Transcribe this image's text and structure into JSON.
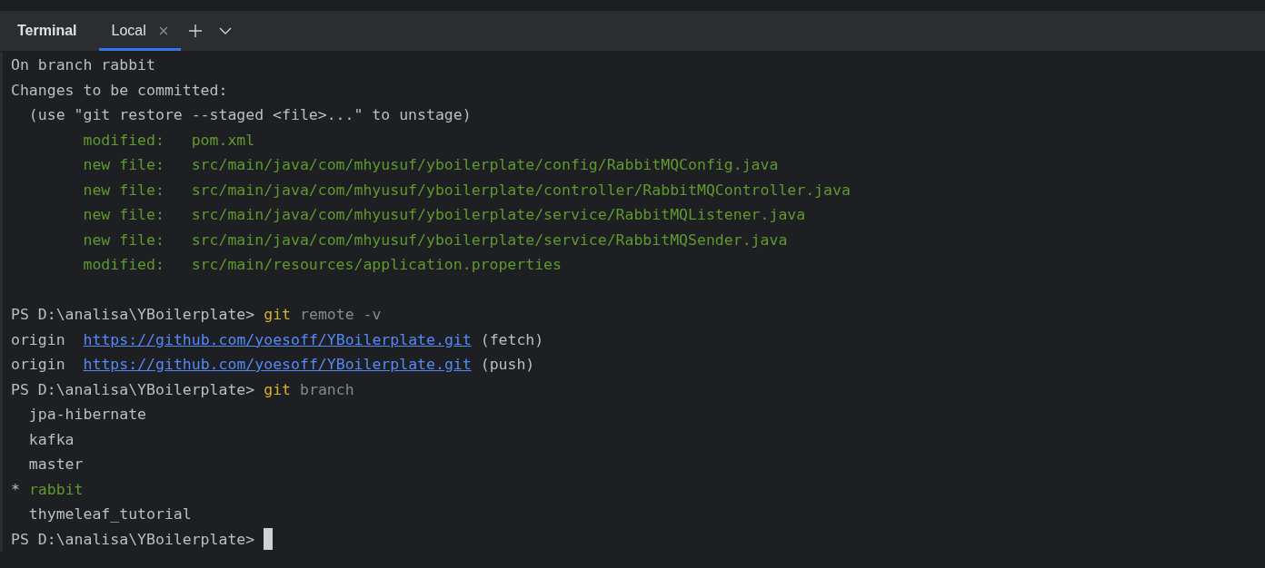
{
  "panel": {
    "title": "Terminal",
    "tabs": [
      {
        "label": "Local",
        "selected": true
      }
    ]
  },
  "lines": [
    {
      "kind": "text",
      "segments": [
        {
          "kind": "plain",
          "text": "On branch rabbit"
        }
      ]
    },
    {
      "kind": "text",
      "segments": [
        {
          "kind": "plain",
          "text": "Changes to be committed:"
        }
      ]
    },
    {
      "kind": "text",
      "segments": [
        {
          "kind": "plain",
          "text": "  (use \"git restore --staged <file>...\" to unstage)"
        }
      ]
    },
    {
      "kind": "text",
      "segments": [
        {
          "kind": "staged",
          "text": "        modified:   pom.xml"
        }
      ]
    },
    {
      "kind": "text",
      "segments": [
        {
          "kind": "staged",
          "text": "        new file:   src/main/java/com/mhyusuf/yboilerplate/config/RabbitMQConfig.java"
        }
      ]
    },
    {
      "kind": "text",
      "segments": [
        {
          "kind": "staged",
          "text": "        new file:   src/main/java/com/mhyusuf/yboilerplate/controller/RabbitMQController.java"
        }
      ]
    },
    {
      "kind": "text",
      "segments": [
        {
          "kind": "staged",
          "text": "        new file:   src/main/java/com/mhyusuf/yboilerplate/service/RabbitMQListener.java"
        }
      ]
    },
    {
      "kind": "text",
      "segments": [
        {
          "kind": "staged",
          "text": "        new file:   src/main/java/com/mhyusuf/yboilerplate/service/RabbitMQSender.java"
        }
      ]
    },
    {
      "kind": "text",
      "segments": [
        {
          "kind": "staged",
          "text": "        modified:   src/main/resources/application.properties"
        }
      ]
    },
    {
      "kind": "blank"
    },
    {
      "kind": "text",
      "segments": [
        {
          "kind": "prompt",
          "text": "PS D:\\analisa\\YBoilerplate>"
        },
        {
          "kind": "command",
          "text": "git"
        },
        {
          "kind": "argument",
          "text": "remote -v"
        }
      ]
    },
    {
      "kind": "text",
      "segments": [
        {
          "kind": "plain",
          "text": "origin "
        },
        {
          "kind": "link",
          "text": "https://github.com/yoesoff/YBoilerplate.git"
        },
        {
          "kind": "plain",
          "text": "(fetch)"
        }
      ]
    },
    {
      "kind": "text",
      "segments": [
        {
          "kind": "plain",
          "text": "origin "
        },
        {
          "kind": "link",
          "text": "https://github.com/yoesoff/YBoilerplate.git"
        },
        {
          "kind": "plain",
          "text": "(push)"
        }
      ]
    },
    {
      "kind": "text",
      "segments": [
        {
          "kind": "prompt",
          "text": "PS D:\\analisa\\YBoilerplate>"
        },
        {
          "kind": "command",
          "text": "git"
        },
        {
          "kind": "argument",
          "text": "branch"
        }
      ]
    },
    {
      "kind": "text",
      "segments": [
        {
          "kind": "plain",
          "text": "  jpa-hibernate"
        }
      ]
    },
    {
      "kind": "text",
      "segments": [
        {
          "kind": "plain",
          "text": "  kafka"
        }
      ]
    },
    {
      "kind": "text",
      "segments": [
        {
          "kind": "plain",
          "text": "  master"
        }
      ]
    },
    {
      "kind": "text",
      "segments": [
        {
          "kind": "plain",
          "text": "*"
        },
        {
          "kind": "current",
          "text": "rabbit"
        }
      ]
    },
    {
      "kind": "text",
      "segments": [
        {
          "kind": "plain",
          "text": "  thymeleaf_tutorial"
        }
      ]
    },
    {
      "kind": "text",
      "cursor": true,
      "segments": [
        {
          "kind": "prompt",
          "text": "PS D:\\analisa\\YBoilerplate>"
        }
      ]
    }
  ]
}
